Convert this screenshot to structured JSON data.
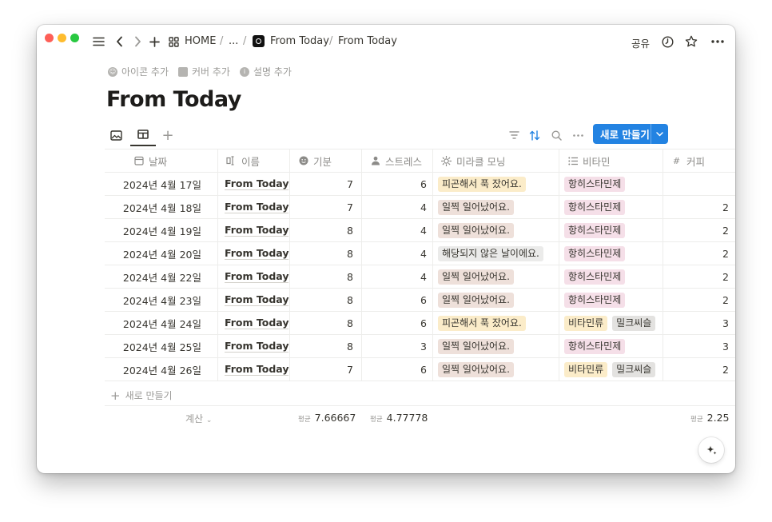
{
  "titlebar": {
    "breadcrumb": {
      "home": "HOME",
      "ellipsis": "...",
      "sep": "/",
      "page1": "From Today",
      "page2": "From Today"
    },
    "share": "공유"
  },
  "meta": {
    "add_icon": "아이콘 추가",
    "add_cover": "커버 추가",
    "add_description": "설명 추가"
  },
  "page_title": "From Today",
  "toolbar": {
    "new_button": "새로 만들기"
  },
  "columns": [
    "날짜",
    "이름",
    "기분",
    "스트레스",
    "미라클 모닝",
    "비타민",
    "커피"
  ],
  "rows": [
    {
      "date": "2024년 4월 17일",
      "name": "From Today",
      "mood": "7",
      "stress": "6",
      "morning": "피곤해서 푹 잤어요.",
      "morning_color": "#fbecc9",
      "vitamins": [
        {
          "label": "항히스타민제",
          "color": "#f5dfe8"
        }
      ],
      "coffee": ""
    },
    {
      "date": "2024년 4월 18일",
      "name": "From Today",
      "mood": "7",
      "stress": "4",
      "morning": "일찍 일어났어요.",
      "morning_color": "#eee0da",
      "vitamins": [
        {
          "label": "항히스타민제",
          "color": "#f5dfe8"
        }
      ],
      "coffee": "2"
    },
    {
      "date": "2024년 4월 19일",
      "name": "From Today",
      "mood": "8",
      "stress": "4",
      "morning": "일찍 일어났어요.",
      "morning_color": "#eee0da",
      "vitamins": [
        {
          "label": "항히스타민제",
          "color": "#f5dfe8"
        }
      ],
      "coffee": "2"
    },
    {
      "date": "2024년 4월 20일",
      "name": "From Today",
      "mood": "8",
      "stress": "4",
      "morning": "해당되지 않은 날이에요.",
      "morning_color": "#ebebea",
      "vitamins": [
        {
          "label": "항히스타민제",
          "color": "#f5dfe8"
        }
      ],
      "coffee": "2"
    },
    {
      "date": "2024년 4월 22일",
      "name": "From Today",
      "mood": "8",
      "stress": "4",
      "morning": "일찍 일어났어요.",
      "morning_color": "#eee0da",
      "vitamins": [
        {
          "label": "항히스타민제",
          "color": "#f5dfe8"
        }
      ],
      "coffee": "2"
    },
    {
      "date": "2024년 4월 23일",
      "name": "From Today",
      "mood": "8",
      "stress": "6",
      "morning": "일찍 일어났어요.",
      "morning_color": "#eee0da",
      "vitamins": [
        {
          "label": "항히스타민제",
          "color": "#f5dfe8"
        }
      ],
      "coffee": "2"
    },
    {
      "date": "2024년 4월 24일",
      "name": "From Today",
      "mood": "8",
      "stress": "6",
      "morning": "피곤해서 푹 잤어요.",
      "morning_color": "#fbecc9",
      "vitamins": [
        {
          "label": "비타민류",
          "color": "#fbecc9"
        },
        {
          "label": "밀크씨슬",
          "color": "#e3e2e0"
        }
      ],
      "coffee": "3"
    },
    {
      "date": "2024년 4월 25일",
      "name": "From Today",
      "mood": "8",
      "stress": "3",
      "morning": "일찍 일어났어요.",
      "morning_color": "#eee0da",
      "vitamins": [
        {
          "label": "항히스타민제",
          "color": "#f5dfe8"
        }
      ],
      "coffee": "3"
    },
    {
      "date": "2024년 4월 26일",
      "name": "From Today",
      "mood": "7",
      "stress": "6",
      "morning": "일찍 일어났어요.",
      "morning_color": "#eee0da",
      "vitamins": [
        {
          "label": "비타민류",
          "color": "#fbecc9"
        },
        {
          "label": "밀크씨슬",
          "color": "#e3e2e0"
        }
      ],
      "coffee": "2"
    }
  ],
  "add_row": "새로 만들기",
  "calc": {
    "label": "계산",
    "avg_label": "평균",
    "mood_avg": "7.66667",
    "stress_avg": "4.77778",
    "coffee_avg": "2.25"
  },
  "colors": {
    "accent": "#2383e2"
  }
}
